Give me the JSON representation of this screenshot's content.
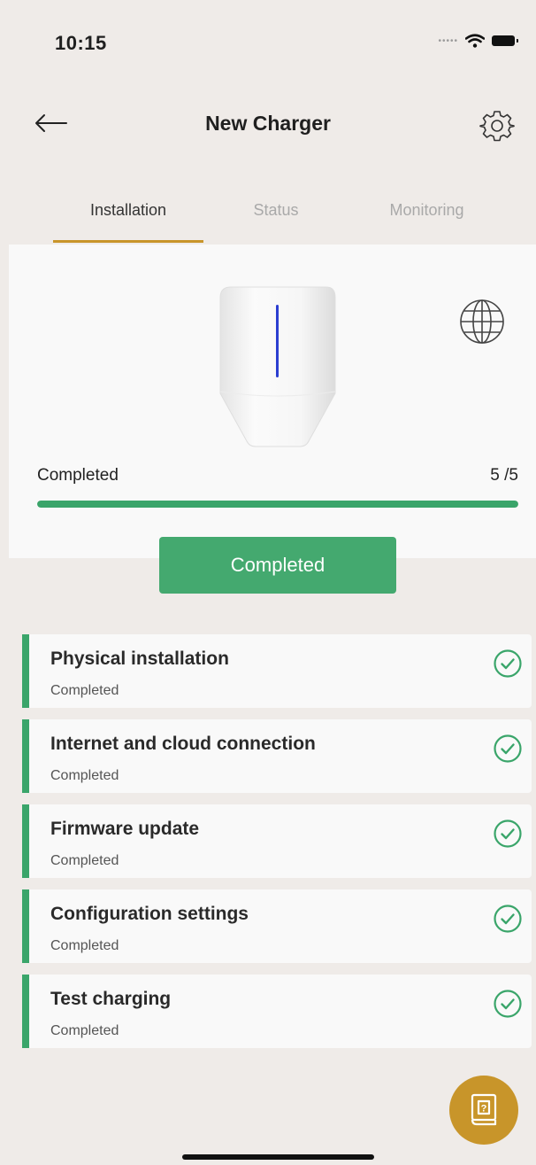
{
  "status_bar": {
    "time": "10:15",
    "signal_icon": "signal-dots-icon",
    "wifi_icon": "wifi-icon",
    "battery_icon": "battery-icon"
  },
  "header": {
    "title": "New Charger",
    "back_icon": "arrow-left-icon",
    "settings_icon": "gear-icon"
  },
  "tabs": [
    {
      "label": "Installation",
      "active": true
    },
    {
      "label": "Status",
      "active": false
    },
    {
      "label": "Monitoring",
      "active": false
    }
  ],
  "device": {
    "image": "wallbox-charger",
    "language_icon": "globe-icon"
  },
  "progress": {
    "label": "Completed",
    "count_text": "5 /5",
    "completed": 5,
    "total": 5
  },
  "primary_button": {
    "label": "Completed"
  },
  "steps": [
    {
      "title": "Physical installation",
      "status": "Completed"
    },
    {
      "title": "Internet and cloud connection",
      "status": "Completed"
    },
    {
      "title": "Firmware update",
      "status": "Completed"
    },
    {
      "title": "Configuration settings",
      "status": "Completed"
    },
    {
      "title": "Test charging",
      "status": "Completed"
    }
  ],
  "help_button": {
    "icon": "help-book-icon"
  },
  "colors": {
    "accent": "#c8952a",
    "success": "#3aa56a",
    "button_green": "#44a96f",
    "background": "#efebe8",
    "card": "#f9f9f9"
  }
}
